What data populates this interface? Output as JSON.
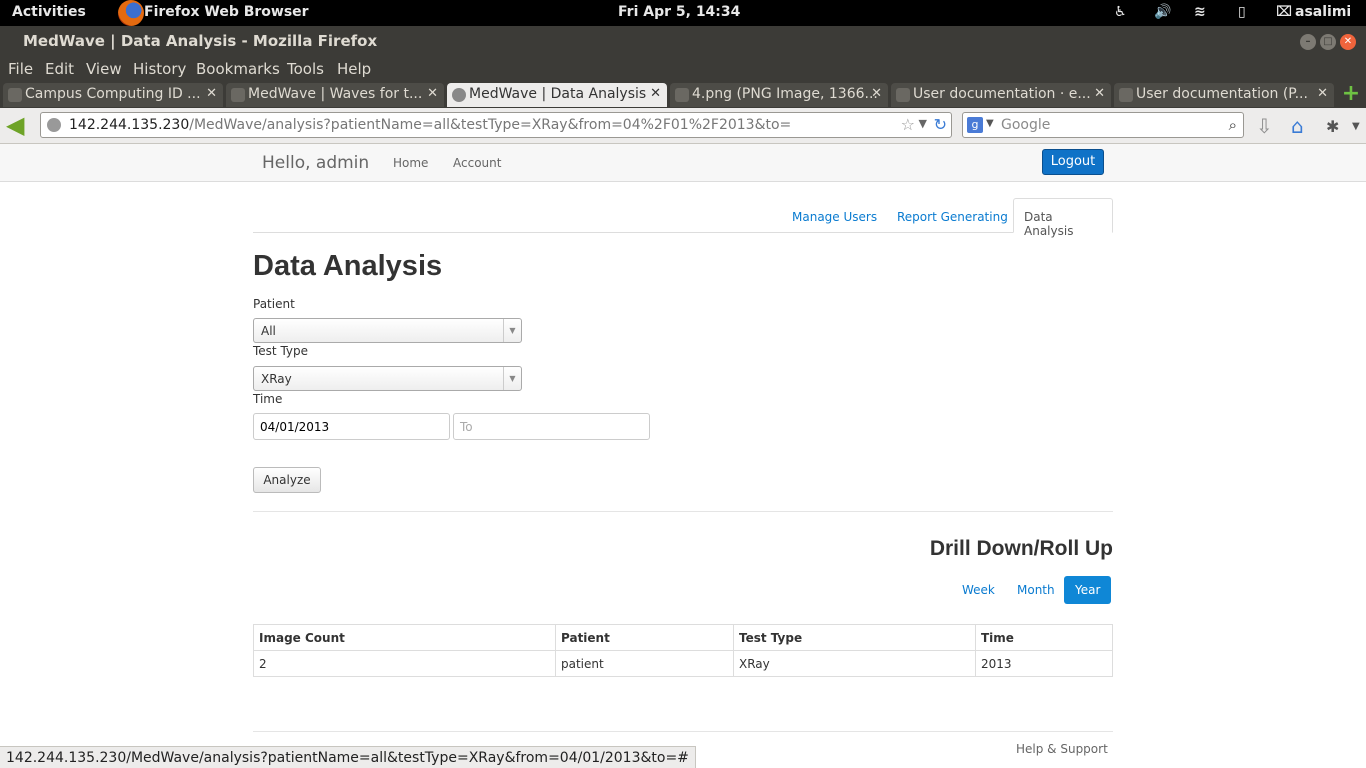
{
  "system_bar": {
    "activities": "Activities",
    "app_name": "Firefox Web Browser",
    "clock": "Fri Apr  5, 14:34",
    "user": "asalimi"
  },
  "window": {
    "title": "MedWave | Data Analysis - Mozilla Firefox"
  },
  "menu": [
    "File",
    "Edit",
    "View",
    "History",
    "Bookmarks",
    "Tools",
    "Help"
  ],
  "tabs": [
    {
      "label": "Campus Computing ID ..."
    },
    {
      "label": "MedWave | Waves for t..."
    },
    {
      "label": "MedWave | Data Analysis"
    },
    {
      "label": "4.png (PNG Image, 1366..."
    },
    {
      "label": "User documentation · e..."
    },
    {
      "label": "User documentation (P..."
    }
  ],
  "urlbar": {
    "host": "142.244.135.230",
    "path": "/MedWave/analysis?patientName=all&testType=XRay&from=04%2F01%2F2013&to="
  },
  "search": {
    "engine_icon": "g",
    "placeholder": "Google"
  },
  "app_nav": {
    "greeting": "Hello, admin",
    "home": "Home",
    "account": "Account",
    "logout": "Logout"
  },
  "page_tabs": {
    "manage_users": "Manage Users",
    "report_generating": "Report Generating",
    "data_analysis": "Data Analysis"
  },
  "form": {
    "title": "Data Analysis",
    "patient_label": "Patient",
    "patient_value": "All",
    "test_type_label": "Test Type",
    "test_type_value": "XRay",
    "time_label": "Time",
    "from_value": "04/01/2013",
    "to_placeholder": "To",
    "analyze_button": "Analyze"
  },
  "drill": {
    "title": "Drill Down/Roll Up",
    "week": "Week",
    "month": "Month",
    "year": "Year"
  },
  "results": {
    "headers": [
      "Image Count",
      "Patient",
      "Test Type",
      "Time"
    ],
    "rows": [
      [
        "2",
        "patient",
        "XRay",
        "2013"
      ]
    ]
  },
  "footer": {
    "help": "Help & Support"
  },
  "status": "142.244.135.230/MedWave/analysis?patientName=all&testType=XRay&from=04/01/2013&to=#"
}
